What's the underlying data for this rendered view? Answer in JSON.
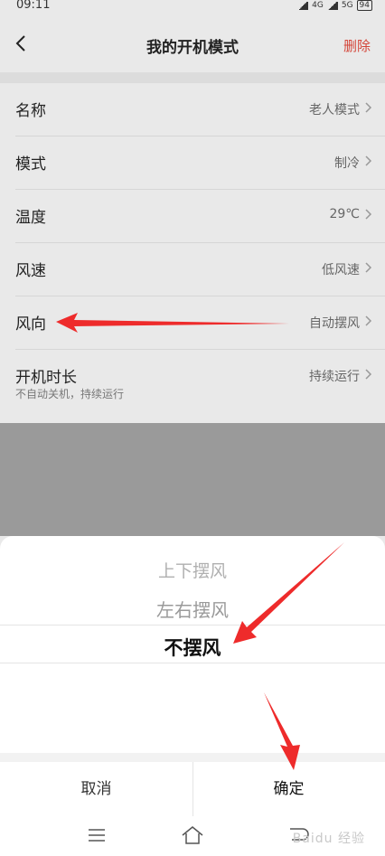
{
  "status_bar": {
    "time": "09:11",
    "net1": "4G",
    "net2": "5G",
    "battery": "94"
  },
  "nav": {
    "title": "我的开机模式",
    "delete": "删除"
  },
  "settings": [
    {
      "label": "名称",
      "value": "老人模式"
    },
    {
      "label": "模式",
      "value": "制冷"
    },
    {
      "label": "温度",
      "value": "29℃"
    },
    {
      "label": "风速",
      "value": "低风速"
    },
    {
      "label": "风向",
      "value": "自动摆风"
    },
    {
      "label": "开机时长",
      "value": "持续运行",
      "sub": "不自动关机，持续运行"
    }
  ],
  "picker": {
    "options": [
      "上下摆风",
      "左右摆风",
      "不摆风"
    ],
    "selected": "不摆风"
  },
  "sheet_buttons": {
    "cancel": "取消",
    "confirm": "确定"
  },
  "watermark": "Baidu 经验"
}
